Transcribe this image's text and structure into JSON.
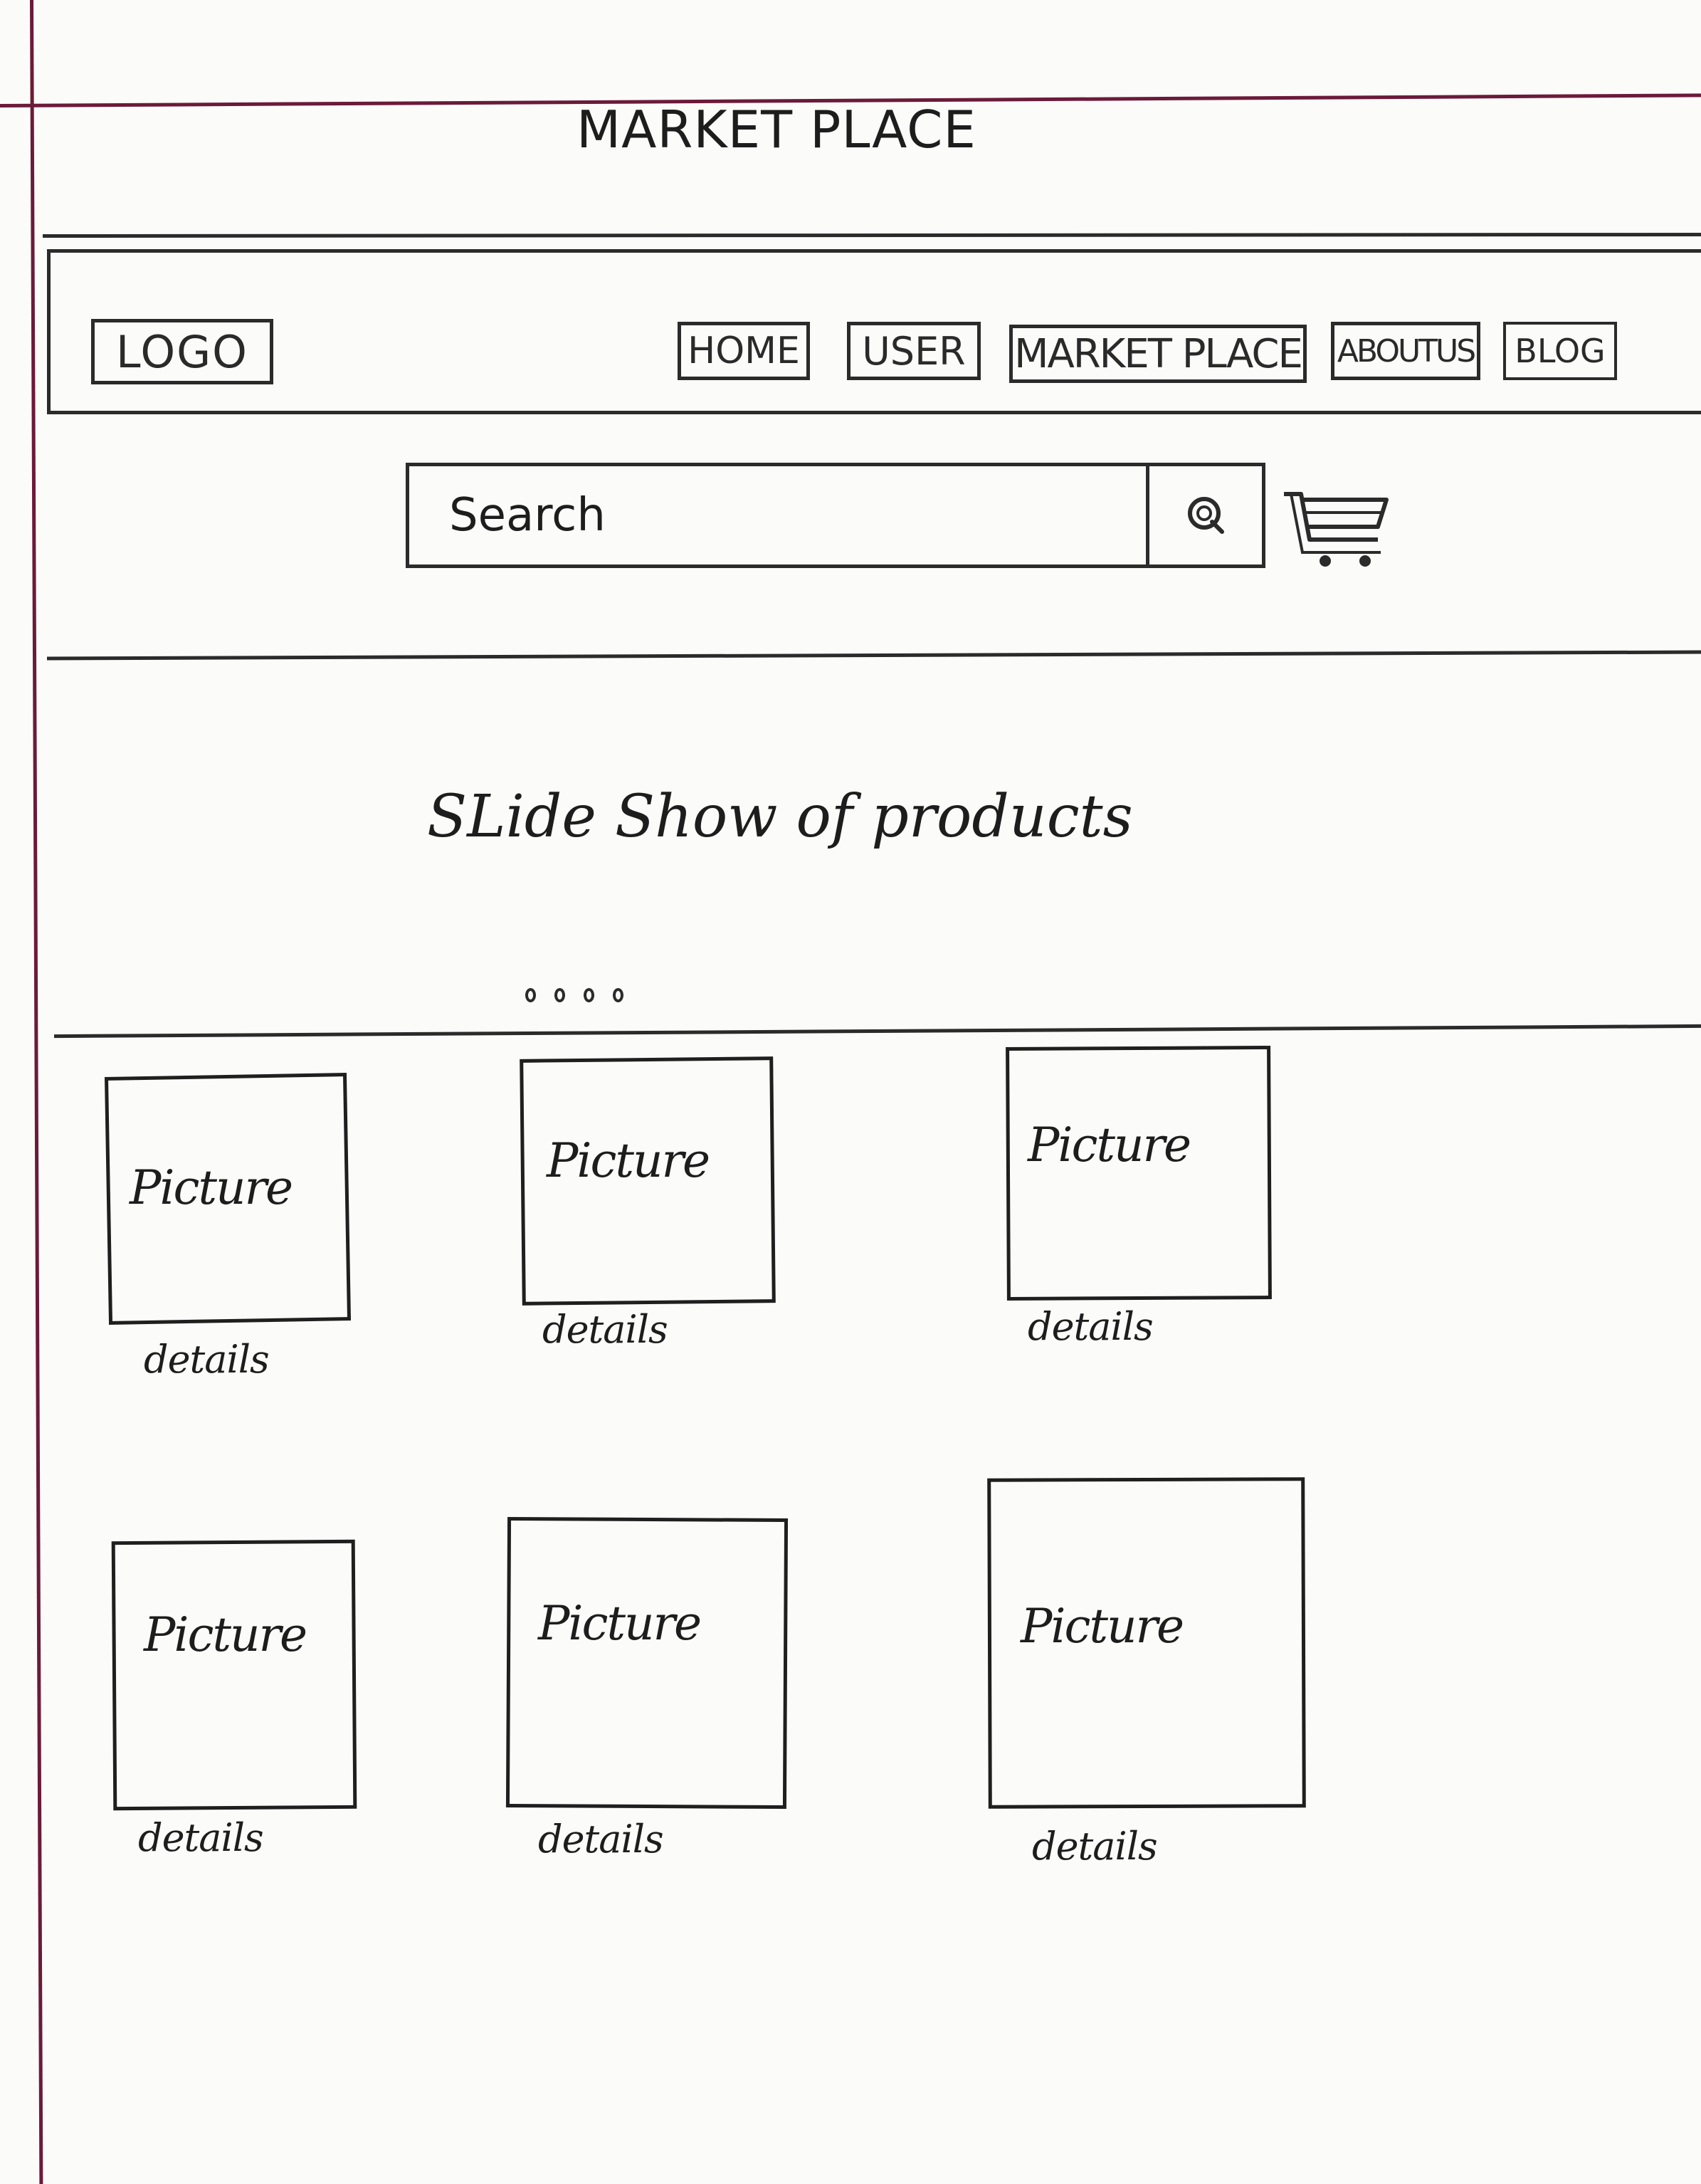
{
  "header": {
    "title": "MARKET PLACE"
  },
  "nav": {
    "logo": "LOGO",
    "items": [
      {
        "label": "HOME"
      },
      {
        "label": "USER"
      },
      {
        "label": "MARKET PLACE"
      },
      {
        "label": "ABOUTUS"
      },
      {
        "label": "BLOG"
      }
    ]
  },
  "search": {
    "placeholder": "Search",
    "button_icon": "search-icon",
    "cart_icon": "cart-icon"
  },
  "slideshow": {
    "text": "SLide Show of products",
    "dot_count": 4
  },
  "products": [
    {
      "picture": "Picture",
      "details": "details"
    },
    {
      "picture": "Picture",
      "details": "details"
    },
    {
      "picture": "Picture",
      "details": "details"
    },
    {
      "picture": "Picture",
      "details": "details"
    },
    {
      "picture": "Picture",
      "details": "details"
    },
    {
      "picture": "Picture",
      "details": "details"
    }
  ]
}
